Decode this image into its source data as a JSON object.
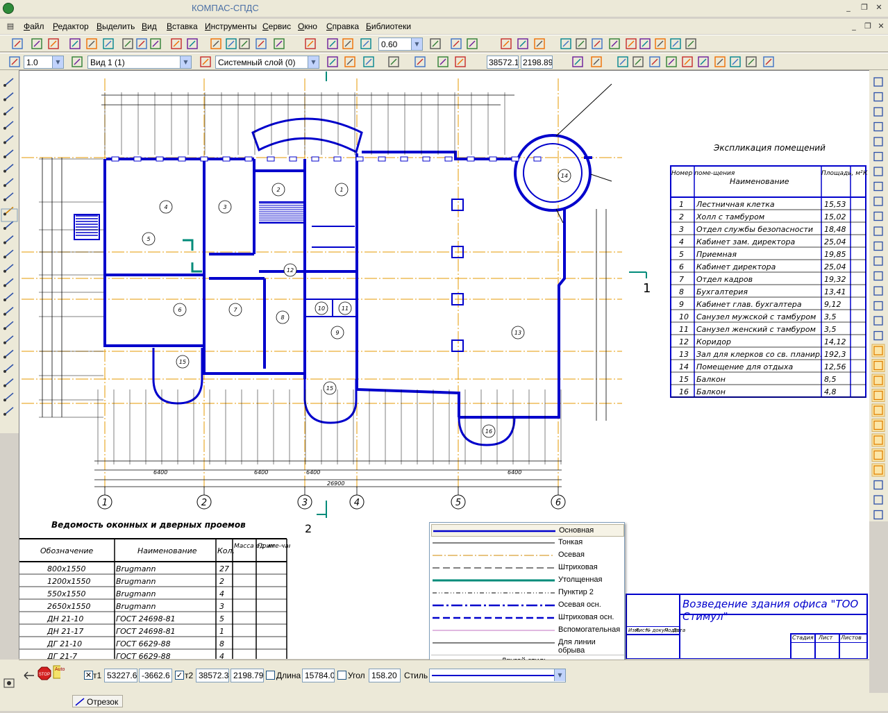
{
  "app": {
    "title": "КОМПАС-СПДС"
  },
  "menu": [
    "Файл",
    "Редактор",
    "Выделить",
    "Вид",
    "Вставка",
    "Инструменты",
    "Сервис",
    "Окно",
    "Справка",
    "Библиотеки"
  ],
  "toolbar": {
    "zoom_value": "0.60",
    "scale_value": "1.0",
    "view_value": "Вид 1 (1)",
    "layer_value": "Системный слой (0)",
    "coord_x": "38572.1",
    "coord_y": "2198.89"
  },
  "drawing": {
    "explication_title": "Экспликация помещений",
    "explication_headers": [
      "Номер поме-щения",
      "Наименование",
      "Площадь, м²",
      "Кат. поме-щения"
    ],
    "rooms": [
      {
        "num": "1",
        "name": "Лестничная клетка",
        "area": "15,53"
      },
      {
        "num": "2",
        "name": "Холл с тамбуром",
        "area": "15,02"
      },
      {
        "num": "3",
        "name": "Отдел службы безопасности",
        "area": "18,48"
      },
      {
        "num": "4",
        "name": "Кабинет зам. директора",
        "area": "25,04"
      },
      {
        "num": "5",
        "name": "Приемная",
        "area": "19,85"
      },
      {
        "num": "6",
        "name": "Кабинет директора",
        "area": "25,04"
      },
      {
        "num": "7",
        "name": "Отдел кадров",
        "area": "19,32"
      },
      {
        "num": "8",
        "name": "Бухгалтерия",
        "area": "13,41"
      },
      {
        "num": "9",
        "name": "Кабинет глав. бухгалтера",
        "area": "9,12"
      },
      {
        "num": "10",
        "name": "Санузел мужской с тамбуром",
        "area": "3,5"
      },
      {
        "num": "11",
        "name": "Санузел женский с тамбуром",
        "area": "3,5"
      },
      {
        "num": "12",
        "name": "Коридор",
        "area": "14,12"
      },
      {
        "num": "13",
        "name": "Зал для клерков со св. планир.",
        "area": "192,3"
      },
      {
        "num": "14",
        "name": "Помещение для отдыха",
        "area": "12,56"
      },
      {
        "num": "15",
        "name": "Балкон",
        "area": "8,5"
      },
      {
        "num": "16",
        "name": "Балкон",
        "area": "4,8"
      }
    ],
    "openings_title": "Ведомость оконных и дверных проемов",
    "openings_headers": [
      "Обозначение",
      "Наименование",
      "Кол.",
      "Масса ед. кг",
      "Приме-чание"
    ],
    "openings": [
      {
        "code": "800х1550",
        "name": "Brugmann",
        "qty": "27"
      },
      {
        "code": "1200х1550",
        "name": "Brugmann",
        "qty": "2"
      },
      {
        "code": "550х1550",
        "name": "Brugmann",
        "qty": "4"
      },
      {
        "code": "2650х1550",
        "name": "Brugmann",
        "qty": "3"
      },
      {
        "code": "ДН 21-10",
        "name": "ГОСТ 24698-81",
        "qty": "5"
      },
      {
        "code": "ДН 21-17",
        "name": "ГОСТ 24698-81",
        "qty": "1"
      },
      {
        "code": "ДГ 21-10",
        "name": "ГОСТ 6629-88",
        "qty": "8"
      },
      {
        "code": "ДГ 21-7",
        "name": "ГОСТ 6629-88",
        "qty": "4"
      }
    ],
    "stamp_title": "Возведение здания офиса \"ТОО Стимул\"",
    "stamp_cols": [
      "Стадия",
      "Лист",
      "Листов"
    ],
    "stamp_left": [
      "Изм.",
      "Лист",
      "№ докум.",
      "Подп.",
      "Дата"
    ],
    "axes": [
      "1",
      "2",
      "3",
      "4",
      "5",
      "6"
    ],
    "section_marks": [
      "1",
      "2"
    ],
    "total_dim": "26900",
    "bottom_dims": [
      "6400",
      "6400",
      "6400",
      "6400"
    ]
  },
  "style_dropdown": {
    "items": [
      "Основная",
      "Тонкая",
      "Осевая",
      "Штриховая",
      "Утолщенная",
      "Пунктир 2",
      "Осевая осн.",
      "Штриховая осн.",
      "Вспомогательная",
      "Для линии обрыва"
    ],
    "other": "Другой стиль..."
  },
  "properties": {
    "t1_label": "т1",
    "t1_x": "53227.6",
    "t1_y": "-3662.6",
    "t2_label": "т2",
    "t2_x": "38572.3",
    "t2_y": "2198.79",
    "length_label": "Длина",
    "length_value": "15784.0",
    "angle_label": "Угол",
    "angle_value": "158.20",
    "style_label": "Стиль"
  },
  "status": {
    "tab": "Отрезок"
  },
  "colors": {
    "wall": "#0000cc",
    "axis": "#e69a00",
    "dim": "#000000",
    "accent": "#008b7a"
  }
}
